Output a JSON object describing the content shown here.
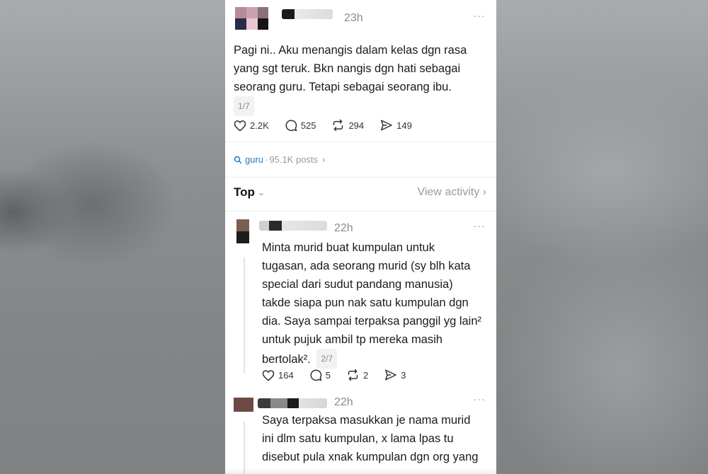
{
  "post1": {
    "time": "23h",
    "text_lines": [
      "Pagi ni.. Aku menangis dalam kelas dgn rasa",
      "yang sgt teruk. Bkn nangis dgn hati sebagai",
      "seorang guru. Tetapi sebagai seorang ibu."
    ],
    "counter": "1/7",
    "likes": "2.2K",
    "replies": "525",
    "reposts": "294",
    "shares": "149",
    "more": "···"
  },
  "topic": {
    "name": "guru",
    "separator": "·",
    "count": "95.1K posts",
    "chevron": "›",
    "icon": "search-icon",
    "color": "#2a7ab8"
  },
  "sort": {
    "label": "Top",
    "chevron": "⌄",
    "view_activity": "View activity ›"
  },
  "reply1": {
    "time": "22h",
    "text_lines": [
      "Minta murid buat kumpulan untuk",
      "tugasan, ada seorang murid (sy blh kata",
      "special dari sudut pandang manusia)",
      "takde siapa pun nak satu kumpulan dgn",
      "dia. Saya sampai terpaksa panggil yg lain²",
      "untuk pujuk ambil tp mereka masih",
      "bertolak²."
    ],
    "counter": "2/7",
    "likes": "164",
    "replies": "5",
    "reposts": "2",
    "shares": "3",
    "more": "···"
  },
  "reply2": {
    "time": "22h",
    "text_lines": [
      "Saya terpaksa masukkan je nama murid",
      "ini dlm satu kumpulan, x lama lpas tu",
      "disebut pula xnak kumpulan dgn org yang"
    ],
    "more": "···"
  }
}
